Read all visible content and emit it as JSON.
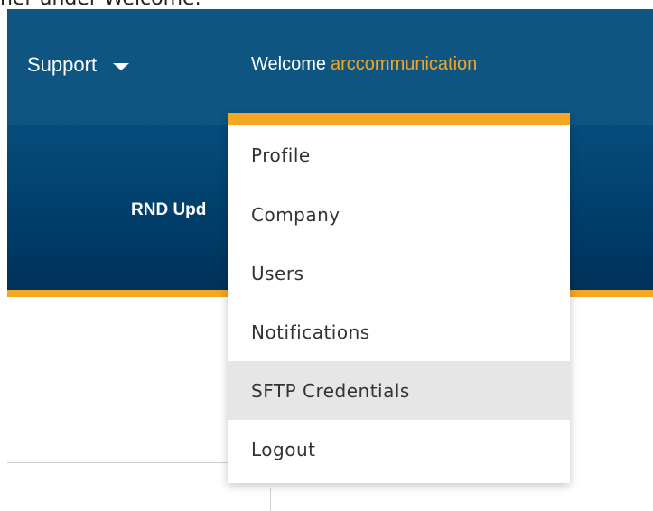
{
  "top_crop": {
    "text": "ner under Welcome."
  },
  "nav": {
    "support_label": "Support",
    "welcome_label": "Welcome",
    "username": "arccommunication"
  },
  "hero": {
    "title": "RND Upd"
  },
  "dropdown": {
    "items": [
      {
        "label": "Profile"
      },
      {
        "label": "Company"
      },
      {
        "label": "Users"
      },
      {
        "label": "Notifications"
      },
      {
        "label": "SFTP Credentials",
        "highlighted": true
      },
      {
        "label": "Logout"
      }
    ]
  },
  "colors": {
    "nav_bg": "#0f5582",
    "hero_bg": "#003a66",
    "accent": "#f5a623",
    "menu_highlight": "#e6e6e6"
  },
  "icons": {
    "caret": "caret-down-icon"
  }
}
